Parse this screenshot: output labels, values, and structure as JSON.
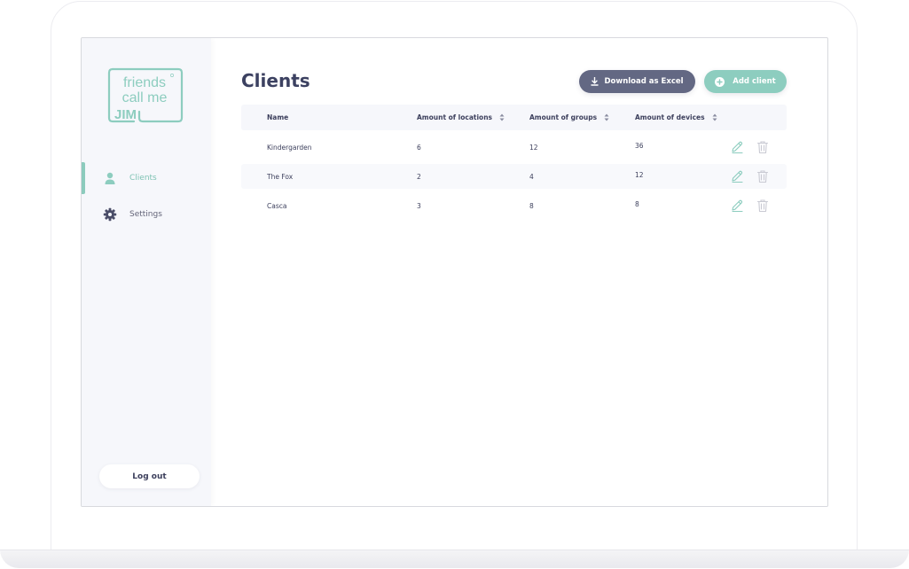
{
  "sidebar": {
    "logo_alt": "friends call me jim",
    "logo_lines": [
      "friends",
      "call me",
      "JIM"
    ],
    "items": [
      {
        "label": "Clients",
        "icon": "user-icon",
        "active": true
      },
      {
        "label": "Settings",
        "icon": "gear-icon",
        "active": false
      }
    ],
    "logout_label": "Log out"
  },
  "header": {
    "title": "Clients",
    "download_label": "Download as Excel",
    "add_label": "Add client"
  },
  "table": {
    "columns": [
      {
        "label": "Name",
        "sortable": false
      },
      {
        "label": "Amount of locations",
        "sortable": true
      },
      {
        "label": "Amount of groups",
        "sortable": true
      },
      {
        "label": "Amount of devices",
        "sortable": true
      }
    ],
    "rows": [
      {
        "name": "Kindergarden",
        "locations": "6",
        "groups": "12",
        "devices": "36"
      },
      {
        "name": "The Fox",
        "locations": "2",
        "groups": "4",
        "devices": "12"
      },
      {
        "name": "Casca",
        "locations": "3",
        "groups": "8",
        "devices": "8"
      }
    ]
  },
  "colors": {
    "accent": "#8dcdbf",
    "primary_dark": "#636883",
    "title": "#3c4161",
    "sidebar_bg": "#f6f7fb"
  }
}
